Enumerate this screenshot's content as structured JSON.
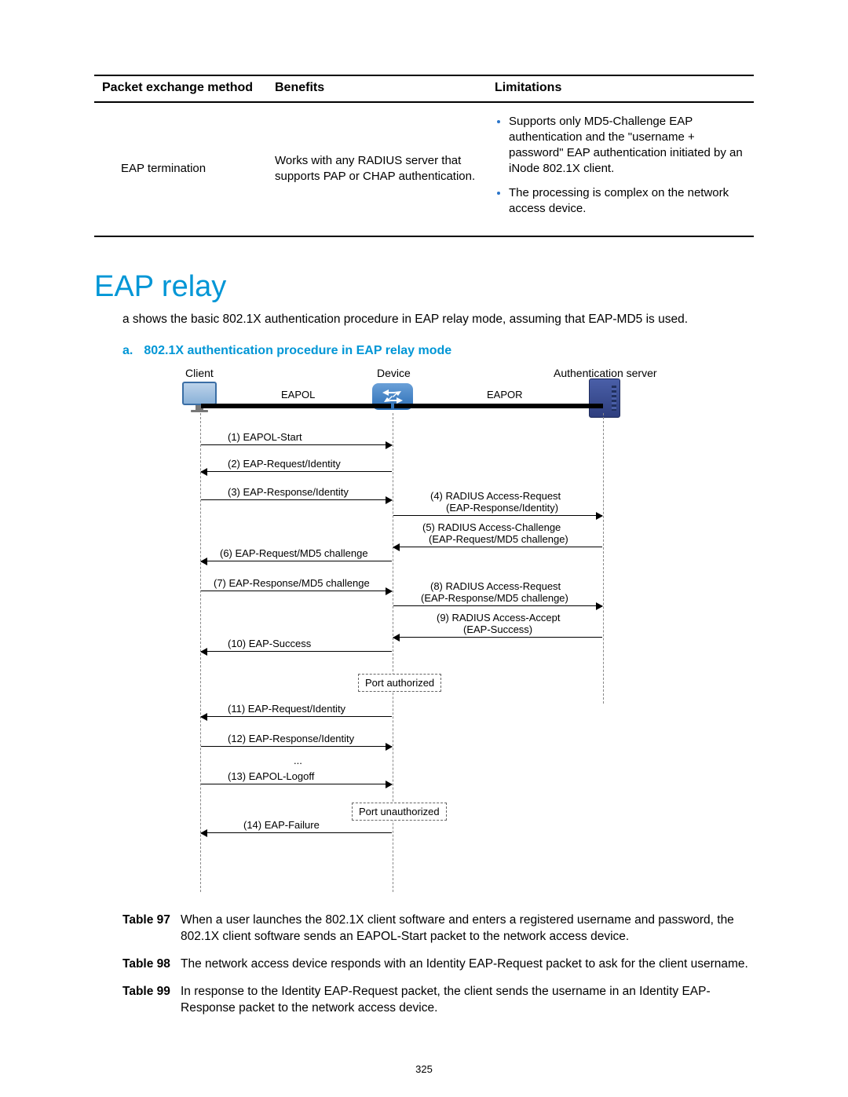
{
  "table": {
    "headers": {
      "method": "Packet exchange method",
      "benefits": "Benefits",
      "limitations": "Limitations"
    },
    "row": {
      "method": "EAP termination",
      "benefits": "Works with any RADIUS server that supports PAP or CHAP authentication.",
      "lim1": "Supports only MD5-Challenge EAP authentication and the \"username + password\" EAP authentication initiated by an iNode 802.1X client.",
      "lim2": "The processing is complex on the network access device."
    }
  },
  "heading": "EAP relay",
  "intro": "a shows the basic 802.1X authentication procedure in EAP relay mode, assuming that EAP-MD5 is used.",
  "caption_num": "a.",
  "caption_text": "802.1X authentication procedure in EAP relay mode",
  "actors": {
    "client": "Client",
    "device": "Device",
    "server": "Authentication server"
  },
  "links": {
    "eapol": "EAPOL",
    "eapor": "EAPOR"
  },
  "msgs": {
    "m1": "(1) EAPOL-Start",
    "m2": "(2) EAP-Request/Identity",
    "m3": "(3) EAP-Response/Identity",
    "m4a": "(4) RADIUS Access-Request",
    "m4b": "(EAP-Response/Identity)",
    "m5a": "(5) RADIUS Access-Challenge",
    "m5b": "(EAP-Request/MD5 challenge)",
    "m6": "(6) EAP-Request/MD5 challenge",
    "m7": "(7) EAP-Response/MD5 challenge",
    "m8a": "(8) RADIUS Access-Request",
    "m8b": "(EAP-Response/MD5 challenge)",
    "m9a": "(9) RADIUS Access-Accept",
    "m9b": "(EAP-Success)",
    "m10": "(10) EAP-Success",
    "state1": "Port authorized",
    "m11": "(11) EAP-Request/Identity",
    "m12": "(12) EAP-Response/Identity",
    "dots": "...",
    "m13": "(13) EAPOL-Logoff",
    "state2": "Port unauthorized",
    "m14": "(14) EAP-Failure"
  },
  "steps": {
    "s1tag": "Table 97",
    "s1": "When a user launches the 802.1X client software and enters a registered username and password, the 802.1X client software sends an EAPOL-Start packet to the network access device.",
    "s2tag": "Table 98",
    "s2": "The network access device responds with an Identity EAP-Request packet to ask for the client username.",
    "s3tag": "Table 99",
    "s3": "In response to the Identity EAP-Request packet, the client sends the username in an Identity EAP-Response packet to the network access device."
  },
  "page_number": "325"
}
